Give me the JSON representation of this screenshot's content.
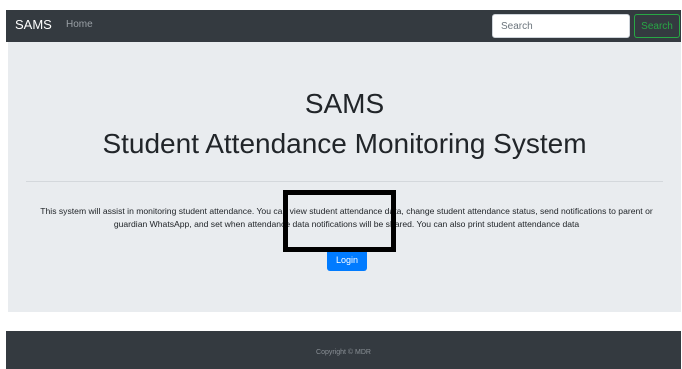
{
  "navbar": {
    "brand": "SAMS",
    "home_label": "Home",
    "search": {
      "placeholder": "Search",
      "value": ""
    },
    "search_button_label": "Search"
  },
  "hero": {
    "title_line1": "SAMS",
    "title_line2": "Student Attendance Monitoring System",
    "description": "This system will assist in monitoring student attendance. You can view student attendance data, change student attendance status, send notifications to parent or guardian WhatsApp, and set when attendance data notifications will be shared. You can also print student attendance data",
    "login_label": "Login"
  },
  "footer": {
    "copyright": "Copyright © MDR"
  },
  "colors": {
    "navbar_bg": "#343a40",
    "jumbotron_bg": "#e9ecef",
    "primary": "#007bff",
    "success": "#28a745",
    "highlight_border": "#000000"
  },
  "icons": []
}
